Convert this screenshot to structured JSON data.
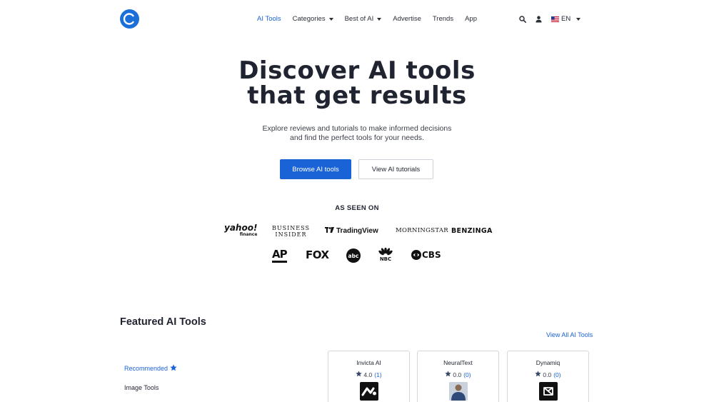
{
  "nav": {
    "items": [
      {
        "label": "AI Tools",
        "active": true,
        "dropdown": false
      },
      {
        "label": "Categories",
        "active": false,
        "dropdown": true
      },
      {
        "label": "Best of AI",
        "active": false,
        "dropdown": true
      },
      {
        "label": "Advertise",
        "active": false,
        "dropdown": false
      },
      {
        "label": "Trends",
        "active": false,
        "dropdown": false
      },
      {
        "label": "App",
        "active": false,
        "dropdown": false
      }
    ],
    "language": "EN"
  },
  "hero": {
    "title_line1": "Discover AI tools",
    "title_line2": "that get results",
    "subtitle": "Explore reviews and tutorials to make informed decisions and find the perfect tools for your needs.",
    "primary_button": "Browse AI tools",
    "secondary_button": "View AI tutorials"
  },
  "press": {
    "label": "AS SEEN ON",
    "yahoo": "yahoo!",
    "yahoo_sub": "finance",
    "business_insider_1": "BUSINESS",
    "business_insider_2": "INSIDER",
    "tradingview": "TradingView",
    "morningstar": "MORNINGSTAR",
    "benzinga": "BENZINGA",
    "ap": "AP",
    "fox": "FOX",
    "abc": "abc",
    "nbc": "NBC",
    "cbs": "CBS"
  },
  "featured": {
    "title": "Featured AI Tools",
    "view_all": "View All AI Tools",
    "sidebar": {
      "recommended": "Recommended",
      "image_tools": "Image Tools"
    },
    "cards": [
      {
        "name": "Invicta AI",
        "rating": "4.0",
        "count": "(1)"
      },
      {
        "name": "NeuralText",
        "rating": "0.0",
        "count": "(0)"
      },
      {
        "name": "Dynamiq",
        "rating": "0.0",
        "count": "(0)"
      }
    ]
  },
  "colors": {
    "accent": "#1a63d6",
    "text": "#1f2430",
    "border": "#d4d8de"
  },
  "icons": [
    "logo-c-icon",
    "search-icon",
    "user-icon",
    "us-flag-icon",
    "chevron-down-icon",
    "star-icon"
  ]
}
